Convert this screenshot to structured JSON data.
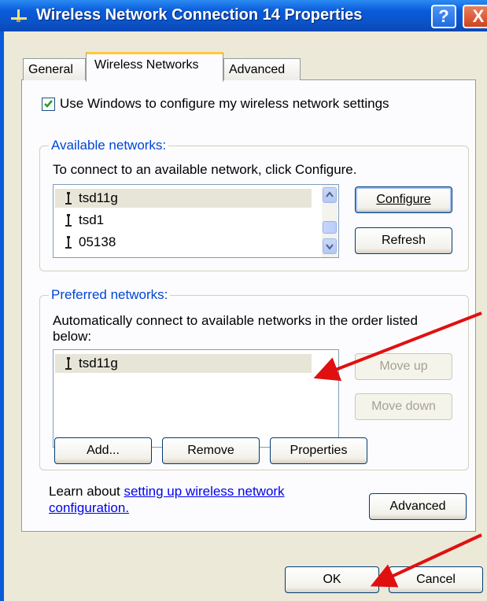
{
  "window": {
    "title": "Wireless Network Connection 14 Properties",
    "help_label": "?",
    "close_label": "X"
  },
  "tabs": [
    {
      "label": "General"
    },
    {
      "label": "Wireless Networks"
    },
    {
      "label": "Advanced"
    }
  ],
  "use_windows": {
    "label": "Use Windows to configure my wireless network settings",
    "checked": true
  },
  "available": {
    "legend": "Available networks:",
    "instruction": "To connect to an available network, click Configure.",
    "networks": [
      "tsd11g",
      "tsd1",
      "05138"
    ],
    "configure_label": "Configure",
    "refresh_label": "Refresh"
  },
  "preferred": {
    "legend": "Preferred networks:",
    "instruction": "Automatically connect to available networks in the order listed below:",
    "networks": [
      "tsd11g"
    ],
    "move_up_label": "Move up",
    "move_down_label": "Move down",
    "add_label": "Add...",
    "remove_label": "Remove",
    "properties_label": "Properties"
  },
  "learn": {
    "prefix": "Learn about ",
    "link_text": "setting up wireless network configuration.",
    "advanced_label": "Advanced"
  },
  "footer": {
    "ok_label": "OK",
    "cancel_label": "Cancel"
  },
  "colors": {
    "titlebar": "#0A5BD9",
    "dialog_bg": "#ECE9D8",
    "accent_text": "#0046D5",
    "annotation_arrow": "#E01010"
  }
}
